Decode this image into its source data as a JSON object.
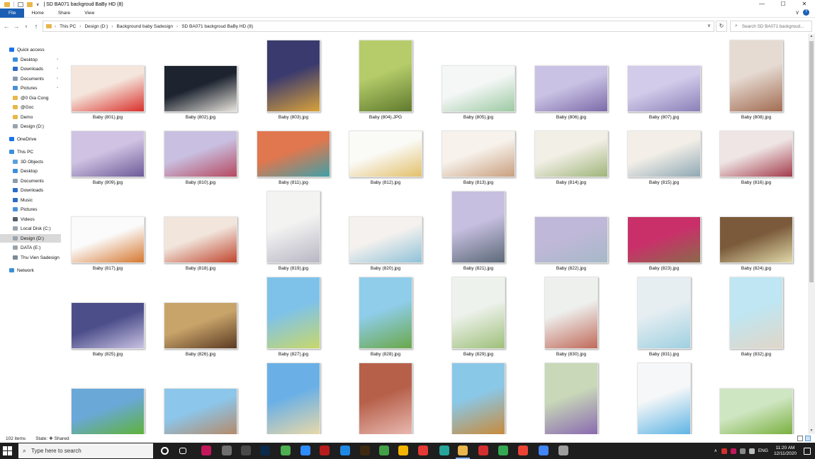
{
  "window": {
    "title": "| SD BA071 backgroud BaBy HD (8)",
    "controls": {
      "minimize": "—",
      "maximize": "☐",
      "close": "✕"
    }
  },
  "ribbon": {
    "tabs": [
      "File",
      "Home",
      "Share",
      "View"
    ],
    "expand": "∨",
    "help": "?"
  },
  "address": {
    "back": "←",
    "forward": "→",
    "recent": "∨",
    "up": "↑",
    "crumbs": [
      "This PC",
      "Design (D:)",
      "Background baby Sadesign",
      "SD BA071 backgroud BaBy HD (8)"
    ],
    "separator": "›",
    "dropdown": "∨",
    "refresh": "↻"
  },
  "search": {
    "placeholder": "Search SD BA071 backgroud...",
    "icon": "search-icon"
  },
  "sidebar": [
    {
      "label": "Quick access",
      "icon": "star-icon",
      "color": "#1a73e8",
      "indent": 0
    },
    {
      "label": "Desktop",
      "icon": "desktop-icon",
      "color": "#3b8fd9",
      "indent": 1,
      "pinned": true
    },
    {
      "label": "Downloads",
      "icon": "download-icon",
      "color": "#2b6cc4",
      "indent": 1,
      "pinned": true
    },
    {
      "label": "Documents",
      "icon": "documents-icon",
      "color": "#8a9bb0",
      "indent": 1,
      "pinned": true
    },
    {
      "label": "Pictures",
      "icon": "pictures-icon",
      "color": "#4a90d9",
      "indent": 1,
      "pinned": true
    },
    {
      "label": "@0 Gia Cong",
      "icon": "folder-icon",
      "color": "#e8b64a",
      "indent": 1
    },
    {
      "label": "@Goc",
      "icon": "folder-icon",
      "color": "#e8b64a",
      "indent": 1
    },
    {
      "label": "Demo",
      "icon": "folder-icon",
      "color": "#e8b64a",
      "indent": 1
    },
    {
      "label": "Design (D:)",
      "icon": "drive-icon",
      "color": "#9aa4ae",
      "indent": 1
    },
    {
      "label": "OneDrive",
      "icon": "cloud-icon",
      "color": "#1a73e8",
      "indent": 0
    },
    {
      "label": "This PC",
      "icon": "computer-icon",
      "color": "#3b8fd9",
      "indent": 0
    },
    {
      "label": "3D Objects",
      "icon": "cube-icon",
      "color": "#5aa0e0",
      "indent": 1
    },
    {
      "label": "Desktop",
      "icon": "desktop-icon",
      "color": "#3b8fd9",
      "indent": 1
    },
    {
      "label": "Documents",
      "icon": "documents-icon",
      "color": "#8a9bb0",
      "indent": 1
    },
    {
      "label": "Downloads",
      "icon": "download-icon",
      "color": "#2b6cc4",
      "indent": 1
    },
    {
      "label": "Music",
      "icon": "music-icon",
      "color": "#2b6cc4",
      "indent": 1
    },
    {
      "label": "Pictures",
      "icon": "pictures-icon",
      "color": "#4a90d9",
      "indent": 1
    },
    {
      "label": "Videos",
      "icon": "videos-icon",
      "color": "#555e68",
      "indent": 1
    },
    {
      "label": "Local Disk (C:)",
      "icon": "drive-icon",
      "color": "#9aa4ae",
      "indent": 1
    },
    {
      "label": "Design (D:)",
      "icon": "drive-icon",
      "color": "#9aa4ae",
      "indent": 1,
      "selected": true
    },
    {
      "label": "DATA  (E:)",
      "icon": "drive-icon",
      "color": "#9aa4ae",
      "indent": 1
    },
    {
      "label": "Thu Vien Sadesign",
      "icon": "network-drive-icon",
      "color": "#7d8a96",
      "indent": 1
    },
    {
      "label": "Network",
      "icon": "network-icon",
      "color": "#3b8fd9",
      "indent": 0
    }
  ],
  "files": [
    {
      "name": "Baby (801).jpg",
      "o": "l",
      "c": [
        "#f4e6dc",
        "#d9302b"
      ]
    },
    {
      "name": "Baby (802).jpg",
      "o": "l",
      "c": [
        "#1d2430",
        "#e9e4dd"
      ]
    },
    {
      "name": "Baby (803).jpg",
      "o": "p",
      "c": [
        "#3b3a6e",
        "#d9a23a"
      ]
    },
    {
      "name": "Baby (804).JPG",
      "o": "p",
      "c": [
        "#b6cc6a",
        "#5f7a2e"
      ]
    },
    {
      "name": "Baby (805).jpg",
      "o": "l",
      "c": [
        "#f4f7f6",
        "#9cc9a2"
      ]
    },
    {
      "name": "Baby (806).jpg",
      "o": "l",
      "c": [
        "#c9c2e4",
        "#7c6aa8"
      ]
    },
    {
      "name": "Baby (807).jpg",
      "o": "l",
      "c": [
        "#d2cbe9",
        "#8a80b8"
      ]
    },
    {
      "name": "Baby (808).jpg",
      "o": "p",
      "c": [
        "#e6dbd3",
        "#a26c52"
      ]
    },
    {
      "name": "Baby (809).jpg",
      "o": "l",
      "c": [
        "#cfc2e2",
        "#6b5a98"
      ]
    },
    {
      "name": "Baby (810).jpg",
      "o": "l",
      "c": [
        "#c9bfe0",
        "#b64860"
      ]
    },
    {
      "name": "Baby (811).jpg",
      "o": "l",
      "c": [
        "#e0774e",
        "#3fa0a8"
      ]
    },
    {
      "name": "Baby (812).jpg",
      "o": "l",
      "c": [
        "#fafaf7",
        "#e3bf6a"
      ]
    },
    {
      "name": "Baby (813).jpg",
      "o": "l",
      "c": [
        "#f7f2ec",
        "#c99f7e"
      ]
    },
    {
      "name": "Baby (814).jpg",
      "o": "l",
      "c": [
        "#f2efe6",
        "#9fb57a"
      ]
    },
    {
      "name": "Baby (815).jpg",
      "o": "l",
      "c": [
        "#f3efe8",
        "#8fa8b4"
      ]
    },
    {
      "name": "Baby (816).jpg",
      "o": "l",
      "c": [
        "#efe5e5",
        "#a23b4a"
      ]
    },
    {
      "name": "Baby (817).jpg",
      "o": "l",
      "c": [
        "#fbfbfb",
        "#d6772f"
      ]
    },
    {
      "name": "Baby (818).jpg",
      "o": "l",
      "c": [
        "#f1e5dc",
        "#c0462e"
      ]
    },
    {
      "name": "Baby (819).jpg",
      "o": "p",
      "c": [
        "#f3f3f2",
        "#b9b6c4"
      ]
    },
    {
      "name": "Baby (820).jpg",
      "o": "l",
      "c": [
        "#f4f1ee",
        "#8fc2d8"
      ]
    },
    {
      "name": "Baby (821).jpg",
      "o": "p",
      "c": [
        "#c7bfe0",
        "#5c6a78"
      ]
    },
    {
      "name": "Baby (822).jpg",
      "o": "l",
      "c": [
        "#bfb8d8",
        "#a6b8c8"
      ]
    },
    {
      "name": "Baby (823).jpg",
      "o": "l",
      "c": [
        "#c9306a",
        "#8a6a4a"
      ]
    },
    {
      "name": "Baby (824).jpg",
      "o": "l",
      "c": [
        "#7a5a3a",
        "#e0d8a8"
      ]
    },
    {
      "name": "Baby (825).jpg",
      "o": "l",
      "c": [
        "#4c4e8a",
        "#c8c2e2"
      ]
    },
    {
      "name": "Baby (826).jpg",
      "o": "l",
      "c": [
        "#c9a46a",
        "#5a3a22"
      ]
    },
    {
      "name": "Baby (827).jpg",
      "o": "p",
      "c": [
        "#7ec2ea",
        "#c8d86a"
      ]
    },
    {
      "name": "Baby (828).jpg",
      "o": "p",
      "c": [
        "#8fcdeb",
        "#6aa84a"
      ]
    },
    {
      "name": "Baby (829).jpg",
      "o": "p",
      "c": [
        "#eef2ec",
        "#9ec07a"
      ]
    },
    {
      "name": "Baby (830).jpg",
      "o": "p",
      "c": [
        "#eef0ee",
        "#c06a5a"
      ]
    },
    {
      "name": "Baby (831).jpg",
      "o": "p",
      "c": [
        "#e6eef2",
        "#9fd0e0"
      ]
    },
    {
      "name": "Baby (832).jpg",
      "o": "p",
      "c": [
        "#bfe6f2",
        "#e0d6c8"
      ]
    },
    {
      "name": "",
      "o": "l",
      "c": [
        "#6aa8d8",
        "#5fb23a"
      ]
    },
    {
      "name": "",
      "o": "l",
      "c": [
        "#8cc6ea",
        "#b48a6a"
      ]
    },
    {
      "name": "",
      "o": "p",
      "c": [
        "#6ab0e6",
        "#e8d8a8"
      ]
    },
    {
      "name": "",
      "o": "p",
      "c": [
        "#b6604a",
        "#e8b8b0"
      ]
    },
    {
      "name": "",
      "o": "p",
      "c": [
        "#8ac8e8",
        "#c88a3a"
      ]
    },
    {
      "name": "",
      "o": "p",
      "c": [
        "#c8d8b8",
        "#8a6ab0"
      ]
    },
    {
      "name": "",
      "o": "p",
      "c": [
        "#f5f7f8",
        "#5fb4e4"
      ]
    },
    {
      "name": "",
      "o": "l",
      "c": [
        "#cfe6c2",
        "#7ab040"
      ]
    }
  ],
  "status": {
    "items": "102 items",
    "state": "State: ❖ Shared"
  },
  "taskbar": {
    "search_placeholder": "Type here to search",
    "apps": [
      {
        "icon": "cortana-icon",
        "color": "#1e1e1e",
        "ring": true
      },
      {
        "icon": "task-view-icon",
        "color": "#1e1e1e"
      },
      {
        "icon": "app-icon",
        "color": "#c2185b"
      },
      {
        "icon": "app-icon",
        "color": "#6f6f6f"
      },
      {
        "icon": "app-icon",
        "color": "#4a4a4a"
      },
      {
        "icon": "photoshop-icon",
        "color": "#0b2a4a"
      },
      {
        "icon": "app-icon",
        "color": "#4caf50"
      },
      {
        "icon": "app-icon",
        "color": "#2d8cff"
      },
      {
        "icon": "filezilla-icon",
        "color": "#b71c1c"
      },
      {
        "icon": "app-icon",
        "color": "#1e88e5"
      },
      {
        "icon": "bridge-icon",
        "color": "#3e2a10"
      },
      {
        "icon": "app-icon",
        "color": "#43a047"
      },
      {
        "icon": "chrome-icon",
        "color": "#f4b400"
      },
      {
        "icon": "app-icon",
        "color": "#e53935"
      },
      {
        "icon": "app-icon",
        "color": "#26a69a"
      },
      {
        "icon": "file-explorer-icon",
        "color": "#e8b64a",
        "active": true
      },
      {
        "icon": "app-icon",
        "color": "#d32f2f"
      },
      {
        "icon": "chrome-icon",
        "color": "#34a853"
      },
      {
        "icon": "chrome-icon",
        "color": "#ea4335"
      },
      {
        "icon": "chrome-icon",
        "color": "#4285f4"
      },
      {
        "icon": "app-icon",
        "color": "#9e9e9e"
      }
    ],
    "tray": {
      "chevron": "∧",
      "lang": "ENG",
      "time": "11:20 AM",
      "date": "12/11/2020"
    }
  }
}
